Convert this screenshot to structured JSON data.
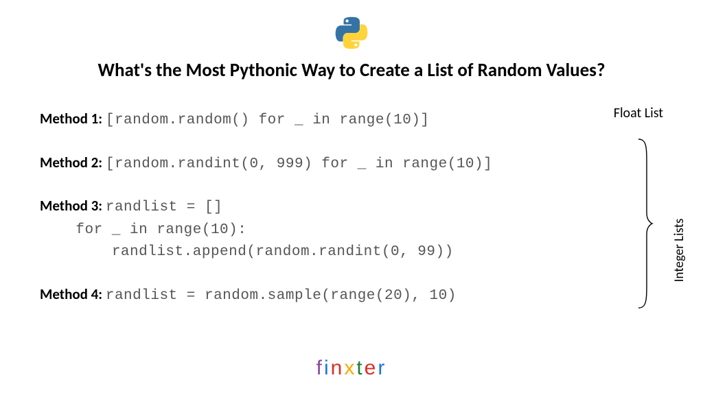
{
  "title": "What's the Most Pythonic Way to Create a List of Random Values?",
  "methods": [
    {
      "label": "Method 1",
      "lines": [
        "[random.random() for _ in range(10)]"
      ]
    },
    {
      "label": "Method 2",
      "lines": [
        "[random.randint(0, 999) for _ in range(10)]"
      ]
    },
    {
      "label": "Method 3",
      "lines": [
        "randlist = []",
        "    for _ in range(10):",
        "        randlist.append(random.randint(0, 99))"
      ]
    },
    {
      "label": "Method 4",
      "lines": [
        "randlist = random.sample(range(20), 10)"
      ]
    }
  ],
  "annotations": {
    "float_label": "Float List",
    "integer_label": "Integer Lists"
  },
  "brand": {
    "l0": "f",
    "l1": "i",
    "l2": "n",
    "l3": "x",
    "l4": "t",
    "l5": "e",
    "l6": "r"
  }
}
